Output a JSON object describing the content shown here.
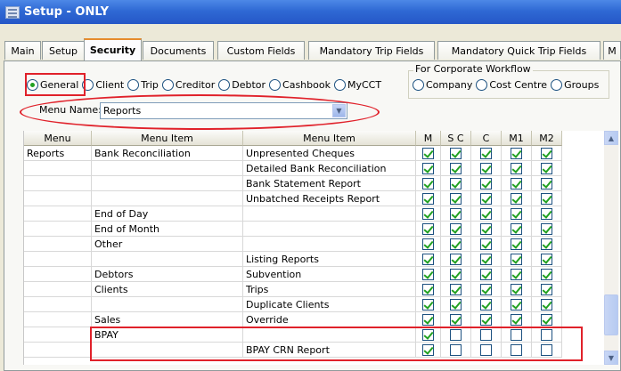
{
  "window": {
    "title": "Setup - ONLY"
  },
  "tabs": [
    {
      "label": "Main"
    },
    {
      "label": "Setup"
    },
    {
      "label": "Security"
    },
    {
      "label": "Documents"
    },
    {
      "label": "Custom Fields"
    },
    {
      "label": "Mandatory Trip Fields"
    },
    {
      "label": "Mandatory Quick Trip Fields"
    },
    {
      "label": "M"
    }
  ],
  "radios": {
    "general": "General",
    "client": "Client",
    "trip": "Trip",
    "creditor": "Creditor",
    "debtor": "Debtor",
    "cashbook": "Cashbook",
    "mycct": "MyCCT"
  },
  "workflow": {
    "label": "For Corporate Workflow",
    "company": "Company",
    "cost_centre": "Cost Centre",
    "groups": "Groups"
  },
  "menu_name": {
    "label": "Menu Name:",
    "value": "Reports"
  },
  "grid": {
    "headers": [
      "Menu",
      "Menu Item",
      "Menu Item",
      "M",
      "S C",
      "C",
      "M1",
      "M2"
    ],
    "rows": [
      {
        "menu": "Reports",
        "item1": "Bank Reconciliation",
        "item2": "Unpresented Cheques",
        "checks": [
          true,
          true,
          true,
          true,
          true
        ]
      },
      {
        "menu": "",
        "item1": "",
        "item2": "Detailed Bank Reconciliation",
        "checks": [
          true,
          true,
          true,
          true,
          true
        ]
      },
      {
        "menu": "",
        "item1": "",
        "item2": "Bank Statement Report",
        "checks": [
          true,
          true,
          true,
          true,
          true
        ]
      },
      {
        "menu": "",
        "item1": "",
        "item2": "Unbatched Receipts Report",
        "checks": [
          true,
          true,
          true,
          true,
          true
        ]
      },
      {
        "menu": "",
        "item1": "End of Day",
        "item2": "",
        "checks": [
          true,
          true,
          true,
          true,
          true
        ]
      },
      {
        "menu": "",
        "item1": "End of Month",
        "item2": "",
        "checks": [
          true,
          true,
          true,
          true,
          true
        ]
      },
      {
        "menu": "",
        "item1": "Other",
        "item2": "",
        "checks": [
          true,
          true,
          true,
          true,
          true
        ]
      },
      {
        "menu": "",
        "item1": "",
        "item2": "Listing Reports",
        "checks": [
          true,
          true,
          true,
          true,
          true
        ]
      },
      {
        "menu": "",
        "item1": "Debtors",
        "item2": "Subvention",
        "checks": [
          true,
          true,
          true,
          true,
          true
        ]
      },
      {
        "menu": "",
        "item1": "Clients",
        "item2": "Trips",
        "checks": [
          true,
          true,
          true,
          true,
          true
        ]
      },
      {
        "menu": "",
        "item1": "",
        "item2": "Duplicate Clients",
        "checks": [
          true,
          true,
          true,
          true,
          true
        ]
      },
      {
        "menu": "",
        "item1": "Sales",
        "item2": "Override",
        "checks": [
          true,
          true,
          true,
          true,
          true
        ]
      },
      {
        "menu": "",
        "item1": "BPAY",
        "item2": "",
        "checks": [
          true,
          false,
          false,
          false,
          false
        ]
      },
      {
        "menu": "",
        "item1": "",
        "item2": "BPAY CRN Report",
        "checks": [
          true,
          false,
          false,
          false,
          false
        ]
      }
    ]
  },
  "colors": {
    "title_bar": "#2f69d4",
    "annotation": "#e0212a",
    "check": "#21a121",
    "active_tab_accent": "#e68b2c"
  }
}
